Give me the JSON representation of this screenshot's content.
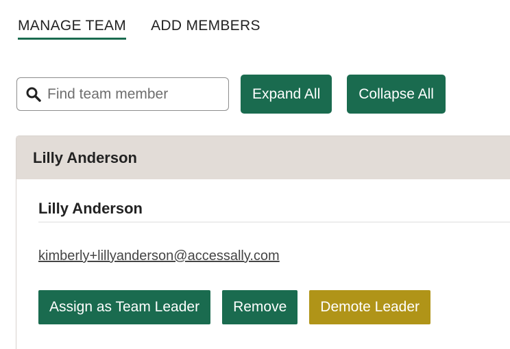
{
  "tabs": [
    {
      "label": "MANAGE TEAM",
      "active": true
    },
    {
      "label": "ADD MEMBERS",
      "active": false
    }
  ],
  "toolbar": {
    "search_placeholder": "Find team member",
    "expand_label": "Expand All",
    "collapse_label": "Collapse All"
  },
  "member": {
    "header_name": "Lilly Anderson",
    "name": "Lilly Anderson",
    "email": "kimberly+lillyanderson@accessally.com",
    "actions": {
      "assign_label": "Assign as Team Leader",
      "remove_label": "Remove",
      "demote_label": "Demote Leader"
    }
  },
  "colors": {
    "primary": "#1a6b4f",
    "warning": "#b09418",
    "header_bg": "#e2dcd7"
  },
  "icons": {
    "search": "search-icon"
  }
}
